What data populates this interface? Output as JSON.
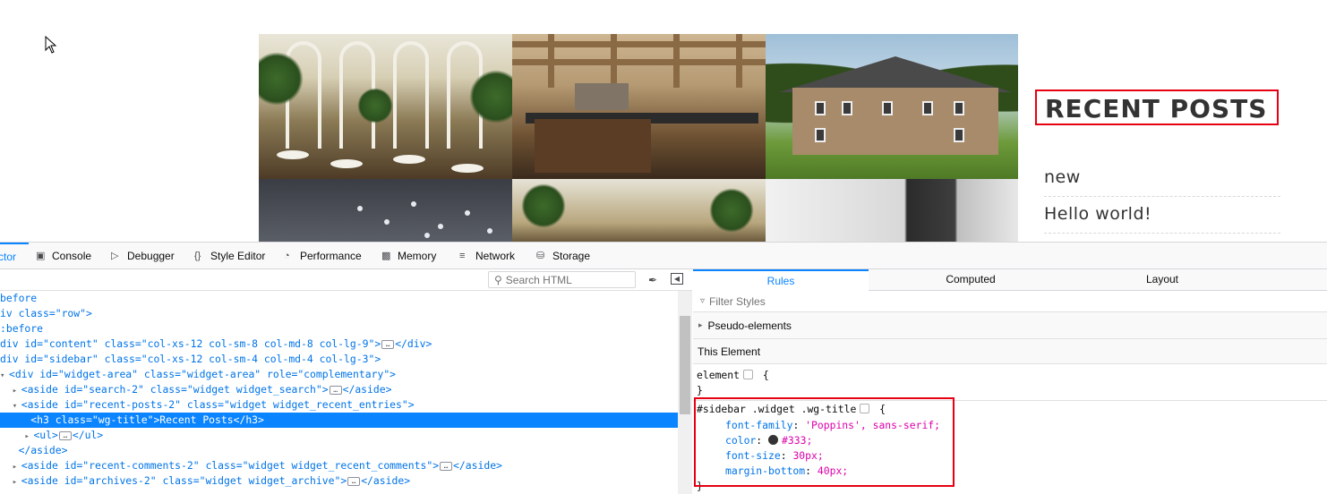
{
  "preview": {
    "recent_posts_title": "RECENT POSTS",
    "posts": [
      "new",
      "Hello world!"
    ]
  },
  "devtools": {
    "tabs": [
      {
        "label": "ctor",
        "icon": "inspector-icon"
      },
      {
        "label": "Console",
        "icon": "console-icon"
      },
      {
        "label": "Debugger",
        "icon": "debugger-icon"
      },
      {
        "label": "Style Editor",
        "icon": "braces-icon"
      },
      {
        "label": "Performance",
        "icon": "gauge-icon"
      },
      {
        "label": "Memory",
        "icon": "memory-chip-icon"
      },
      {
        "label": "Network",
        "icon": "network-icon"
      },
      {
        "label": "Storage",
        "icon": "database-icon"
      }
    ],
    "search_placeholder": "Search HTML",
    "markup_lines": [
      "before",
      "iv class=\"row\">",
      ":before",
      "div id=\"content\" class=\"col-xs-12 col-sm-8 col-md-8 col-lg-9\">",
      "div id=\"sidebar\" class=\"col-xs-12 col-sm-4 col-md-4 col-lg-3\">",
      "<div id=\"widget-area\" class=\"widget-area\" role=\"complementary\">",
      "<aside id=\"search-2\" class=\"widget widget_search\">",
      "<aside id=\"recent-posts-2\" class=\"widget widget_recent_entries\">",
      "<h3 class=\"wg-title\">Recent Posts</h3>",
      "<ul>",
      "</aside>",
      "<aside id=\"recent-comments-2\" class=\"widget widget_recent_comments\">",
      "<aside id=\"archives-2\" class=\"widget widget_archive\">"
    ],
    "rules_tabs": [
      "Rules",
      "Computed",
      "Layout"
    ],
    "filter_placeholder": "Filter Styles",
    "pseudo_elements": "Pseudo-elements",
    "this_element": "This Element",
    "element_rule": "element",
    "selector": "#sidebar .widget .wg-title",
    "declarations": [
      {
        "prop": "font-family",
        "value": "'Poppins', sans-serif;"
      },
      {
        "prop": "color",
        "value": "#333;"
      },
      {
        "prop": "font-size",
        "value": "30px;"
      },
      {
        "prop": "margin-bottom",
        "value": "40px;"
      }
    ]
  },
  "colors": {
    "highlight": "#e60012",
    "accent": "#0a84ff",
    "title_color": "#333333"
  }
}
